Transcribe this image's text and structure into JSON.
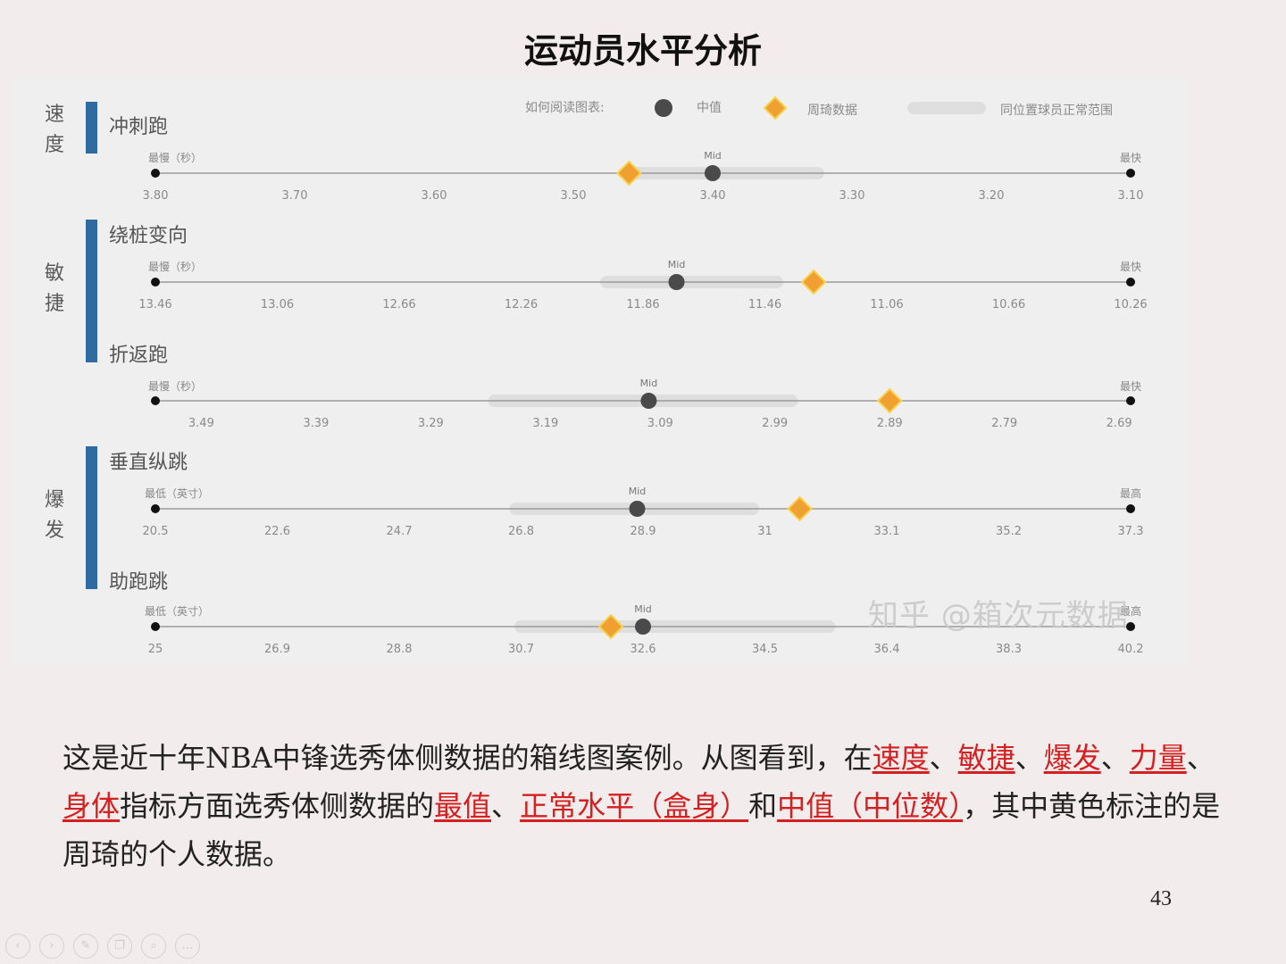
{
  "title": "运动员水平分析",
  "legend": {
    "prefix": "如何阅读图表:",
    "median": "中值",
    "player": "周琦数据",
    "range": "同位置球员正常范围",
    "colors": {
      "median": "#4a4a4a",
      "player": "#f0a030",
      "range": "#dedede"
    }
  },
  "chart_data": {
    "type": "box",
    "categories": [
      {
        "name": "速度",
        "metrics": [
          0
        ]
      },
      {
        "name": "敏捷",
        "metrics": [
          1,
          2
        ]
      },
      {
        "name": "爆发",
        "metrics": [
          3,
          4
        ]
      }
    ],
    "metrics": [
      {
        "name": "冲刺跑",
        "left_label": "最慢（秒）",
        "right_label": "最快",
        "mid_label": "Mid",
        "ticks": [
          "3.80",
          "3.70",
          "3.60",
          "3.50",
          "3.40",
          "3.30",
          "3.20",
          "3.10"
        ],
        "axis": [
          3.8,
          3.1
        ],
        "range": [
          3.46,
          3.32
        ],
        "median": 3.4,
        "player": 3.46
      },
      {
        "name": "绕桩变向",
        "left_label": "最慢（秒）",
        "right_label": "最快",
        "mid_label": "Mid",
        "ticks": [
          "13.46",
          "13.06",
          "12.66",
          "12.26",
          "11.86",
          "11.46",
          "11.06",
          "10.66",
          "10.26"
        ],
        "axis": [
          13.46,
          10.26
        ],
        "range": [
          12.0,
          11.4
        ],
        "median": 11.75,
        "player": 11.3
      },
      {
        "name": "折返跑",
        "left_label": "最慢（秒）",
        "right_label": "最快",
        "mid_label": "Mid",
        "ticks": [
          "3.49",
          "3.39",
          "3.29",
          "3.19",
          "3.09",
          "2.99",
          "2.89",
          "2.79",
          "2.69"
        ],
        "axis": [
          3.53,
          2.68
        ],
        "range": [
          3.24,
          2.97
        ],
        "median": 3.1,
        "player": 2.89
      },
      {
        "name": "垂直纵跳",
        "left_label": "最低（英寸）",
        "right_label": "最高",
        "mid_label": "Mid",
        "ticks": [
          "20.5",
          "22.6",
          "24.7",
          "26.8",
          "28.9",
          "31",
          "33.1",
          "35.2",
          "37.3"
        ],
        "axis": [
          20.5,
          37.3
        ],
        "range": [
          26.6,
          30.9
        ],
        "median": 28.8,
        "player": 31.6
      },
      {
        "name": "助跑跳",
        "left_label": "最低（英寸）",
        "right_label": "最高",
        "mid_label": "Mid",
        "ticks": [
          "25",
          "26.9",
          "28.8",
          "30.7",
          "32.6",
          "34.5",
          "36.4",
          "38.3",
          "40.2"
        ],
        "axis": [
          25,
          40.2
        ],
        "range": [
          30.6,
          35.6
        ],
        "median": 32.6,
        "player": 32.1
      }
    ]
  },
  "watermark": "知乎 @箱次元数据",
  "description": {
    "p1": "这是近十年NBA中锋选秀体侧数据的箱线图案例。从图看到，在",
    "h1": "速度",
    "s1": "、",
    "h2": "敏捷",
    "s2": "、",
    "h3": "爆发",
    "s3": "、",
    "h4": "力量",
    "s4": "、",
    "h5": "身体",
    "p2": "指标方面选秀体侧数据的",
    "h6": "最值",
    "s5": "、",
    "h7": "正常水平（盒身）",
    "p3": "和",
    "h8": "中值（中位数）",
    "p4": "，其中黄色标注的是周琦的个人数据。"
  },
  "page_number": "43",
  "toolbar": {
    "prev": "‹",
    "next": "›",
    "pen": "✎",
    "copy": "❐",
    "zoom": "⌕",
    "more": "…"
  }
}
